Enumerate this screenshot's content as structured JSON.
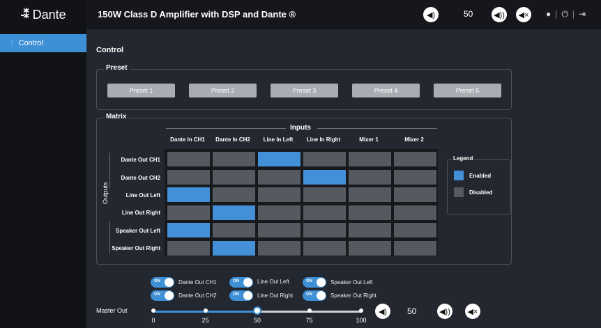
{
  "brand": {
    "logo_text": "Dante",
    "logo_mark": "-⁑"
  },
  "sidebar": {
    "items": [
      {
        "label": "Control",
        "icon": "sliders-icon"
      }
    ]
  },
  "header": {
    "title": "150W Class D Amplifier with DSP and Dante ®",
    "volume_value": "50",
    "icons": [
      "volume-down-icon",
      "volume-up-icon",
      "mute-icon",
      "user-icon",
      "power-icon",
      "logout-icon"
    ]
  },
  "page": {
    "title": "Control"
  },
  "preset": {
    "label": "Preset",
    "buttons": [
      "Preset 1",
      "Preset 2",
      "Preset 3",
      "Preset 4",
      "Preset 5"
    ]
  },
  "matrix": {
    "label": "Matrix",
    "inputs_label": "Inputs",
    "outputs_label": "Outputs",
    "columns": [
      "Dante In CH1",
      "Dante In CH2",
      "Line In Left",
      "Line In Right",
      "Mixer 1",
      "Mixer 2"
    ],
    "rows": [
      "Dante Out CH1",
      "Dante Out CH2",
      "Line Out Left",
      "Line Out Right",
      "Speaker Out Left",
      "Speaker Out Right"
    ],
    "enabled": [
      [
        false,
        false,
        true,
        false,
        false,
        false
      ],
      [
        false,
        false,
        false,
        true,
        false,
        false
      ],
      [
        true,
        false,
        false,
        false,
        false,
        false
      ],
      [
        false,
        true,
        false,
        false,
        false,
        false
      ],
      [
        true,
        false,
        false,
        false,
        false,
        false
      ],
      [
        false,
        true,
        false,
        false,
        false,
        false
      ]
    ],
    "legend": {
      "title": "Legend",
      "enabled": "Enabled",
      "disabled": "Disabled"
    },
    "colors": {
      "enabled": "#4490d8",
      "disabled": "#555960"
    }
  },
  "output_toggles": [
    {
      "label": "Dante Out CH1",
      "state": "ON"
    },
    {
      "label": "Line Out Left",
      "state": "ON"
    },
    {
      "label": "Speaker Out Left",
      "state": "ON"
    },
    {
      "label": "Dante Out CH2",
      "state": "ON"
    },
    {
      "label": "Line Out Right",
      "state": "ON"
    },
    {
      "label": "Speaker Out Right",
      "state": "ON"
    }
  ],
  "master_out": {
    "label": "Master Out",
    "value": 50,
    "value_label": "50",
    "ticks": [
      "0",
      "25",
      "50",
      "75",
      "100"
    ]
  }
}
